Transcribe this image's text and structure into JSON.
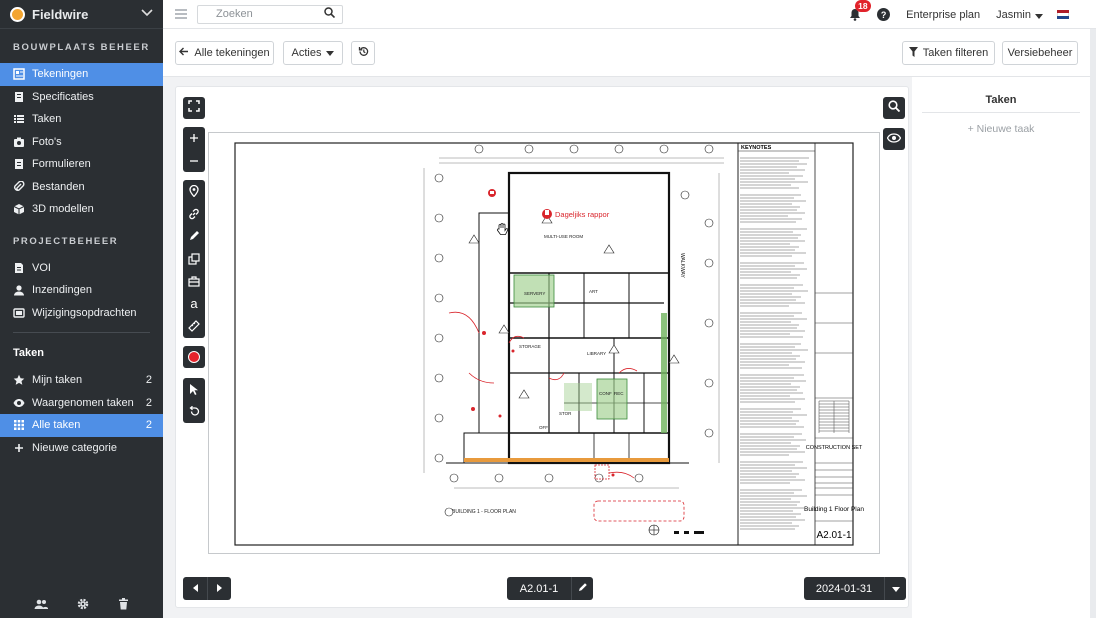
{
  "app": {
    "name": "Fieldwire"
  },
  "sidebar": {
    "section1": "BOUWPLAATS BEHEER",
    "items1": [
      {
        "label": "Tekeningen",
        "icon": "drawings-icon",
        "active": true
      },
      {
        "label": "Specificaties",
        "icon": "specs-icon"
      },
      {
        "label": "Taken",
        "icon": "tasks-icon"
      },
      {
        "label": "Foto's",
        "icon": "camera-icon"
      },
      {
        "label": "Formulieren",
        "icon": "forms-icon"
      },
      {
        "label": "Bestanden",
        "icon": "paperclip-icon"
      },
      {
        "label": "3D modellen",
        "icon": "cube-icon"
      }
    ],
    "section2": "PROJECTBEHEER",
    "items2": [
      {
        "label": "VOI",
        "icon": "document-icon"
      },
      {
        "label": "Inzendingen",
        "icon": "person-icon"
      },
      {
        "label": "Wijzigingsopdrachten",
        "icon": "change-order-icon"
      }
    ],
    "taken_header": "Taken",
    "task_items": [
      {
        "label": "Mijn taken",
        "count": "2",
        "icon": "star-icon"
      },
      {
        "label": "Waargenomen taken",
        "count": "2",
        "icon": "eye-icon"
      },
      {
        "label": "Alle taken",
        "count": "2",
        "icon": "grid-icon",
        "active": true
      },
      {
        "label": "Nieuwe categorie",
        "icon": "plus-icon"
      }
    ]
  },
  "topbar": {
    "search_placeholder": "Zoeken",
    "notifications": "18",
    "plan": "Enterprise plan",
    "user": "Jasmin"
  },
  "toolbar": {
    "back_label": "Alle tekeningen",
    "actions_label": "Acties",
    "filter_label": "Taken filteren",
    "version_label": "Versiebeheer"
  },
  "drawing": {
    "daily_report": "Dageljiks rappor",
    "sheet_title": "Building 1 Floor Plan",
    "sheet_number": "A2.01-1",
    "set_name": "CONSTRUCTION SET",
    "keynotes_title": "KEYNOTES",
    "plan_label": "BUILDING 1 - FLOOR PLAN",
    "room_labels": [
      "MULTI-USE ROOM",
      "SERVERY",
      "ART",
      "STORAGE",
      "LIBRARY",
      "CONF",
      "REC",
      "STOR",
      "OFF",
      "WALKWAY"
    ]
  },
  "bottom": {
    "sheet": "A2.01-1",
    "date": "2024-01-31"
  },
  "right_panel": {
    "title": "Taken",
    "new_task": "+ Nieuwe taak"
  },
  "colors": {
    "accent": "#4f8fe6",
    "sidebar": "#2b2f33",
    "badge": "#e1232b"
  }
}
